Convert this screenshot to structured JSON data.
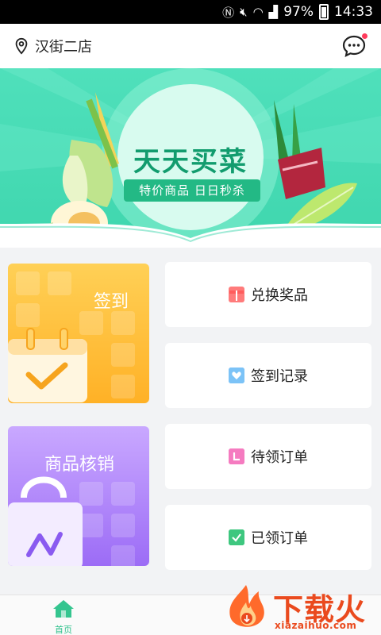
{
  "status_bar": {
    "battery": "97%",
    "time": "14:33"
  },
  "header": {
    "store_name": "汉街二店"
  },
  "banner": {
    "title": "天天买菜",
    "subtitle": "特价商品 日日秒杀"
  },
  "cards": {
    "checkin": "签到",
    "verify": "商品核销"
  },
  "actions": [
    {
      "label": "兑换奖品",
      "icon": "gift-icon",
      "color": "#ff6f6f"
    },
    {
      "label": "签到记录",
      "icon": "heart-icon",
      "color": "#6cb8f5"
    },
    {
      "label": "待领订单",
      "icon": "order-pending-icon",
      "color": "#f26cb6"
    },
    {
      "label": "已领订单",
      "icon": "check-icon",
      "color": "#3cc47c"
    }
  ],
  "bottom_nav": {
    "home_label": "首页"
  },
  "watermark": {
    "text": "下载火",
    "url": "xiazaihuo.com"
  },
  "colors": {
    "accent": "#2fc18c",
    "banner": "#4fe0bb",
    "checkin": "#ffb126",
    "verify": "#9c6cf6"
  }
}
